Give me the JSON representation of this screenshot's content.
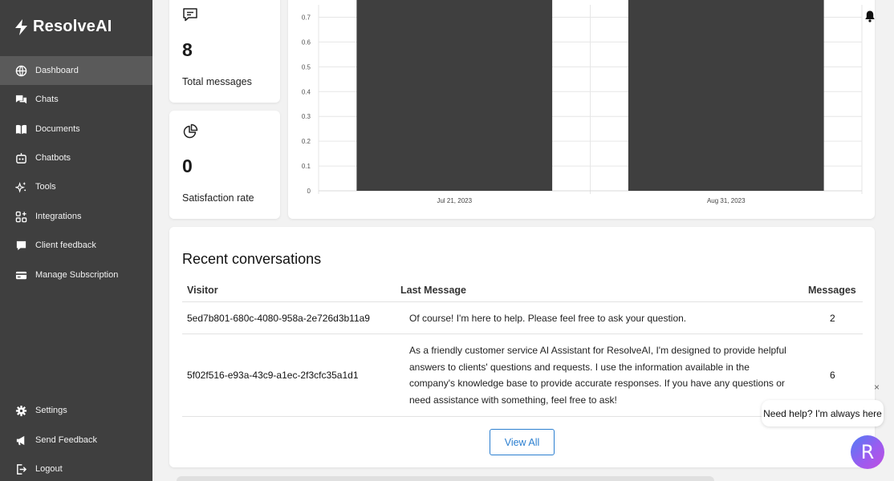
{
  "app": {
    "brand": "ResolveAI"
  },
  "sidebar": {
    "items": [
      {
        "label": "Dashboard",
        "icon": "globe-icon"
      },
      {
        "label": "Chats",
        "icon": "chat-bubbles-icon"
      },
      {
        "label": "Documents",
        "icon": "book-icon"
      },
      {
        "label": "Chatbots",
        "icon": "robot-icon"
      },
      {
        "label": "Tools",
        "icon": "sparkles-icon"
      },
      {
        "label": "Integrations",
        "icon": "grid-plus-icon"
      },
      {
        "label": "Client feedback",
        "icon": "speech-bubble-icon"
      },
      {
        "label": "Manage Subscription",
        "icon": "credit-card-icon"
      }
    ],
    "bottom_items": [
      {
        "label": "Settings",
        "icon": "gear-icon"
      },
      {
        "label": "Send Feedback",
        "icon": "megaphone-icon"
      },
      {
        "label": "Logout",
        "icon": "logout-icon"
      }
    ]
  },
  "stats": {
    "messages": {
      "value": "8",
      "label": "Total messages"
    },
    "satisfaction": {
      "value": "0",
      "label": "Satisfaction rate"
    }
  },
  "chart_data": {
    "type": "bar",
    "categories": [
      "Jul 21, 2023",
      "Aug 31, 2023"
    ],
    "values": [
      0.75,
      0.75
    ],
    "yticks": [
      "0",
      "0.1",
      "0.2",
      "0.3",
      "0.4",
      "0.5",
      "0.6",
      "0.7"
    ],
    "ylim": [
      0,
      0.75
    ],
    "grid": true,
    "bar_color": "#3f3f3f"
  },
  "conversations": {
    "title": "Recent conversations",
    "columns": {
      "visitor": "Visitor",
      "last_message": "Last Message",
      "messages": "Messages"
    },
    "rows": [
      {
        "visitor": "5ed7b801-680c-4080-958a-2e726d3b11a9",
        "last_message": "Of course! I'm here to help. Please feel free to ask your question.",
        "messages": "2"
      },
      {
        "visitor": "5f02f516-e93a-43c9-a1ec-2f3cfc35a1d1",
        "last_message": "As a friendly customer service AI Assistant for ResolveAI, I'm designed to provide helpful answers to clients' questions and requests. I use the information available in the company's knowledge base to provide accurate responses. If you have any questions or need assistance with something, feel free to ask!",
        "messages": "6"
      }
    ],
    "view_all": "View All"
  },
  "help_widget": {
    "bubble": "Need help? I'm always here",
    "avatar_letter": "R",
    "close": "×"
  }
}
